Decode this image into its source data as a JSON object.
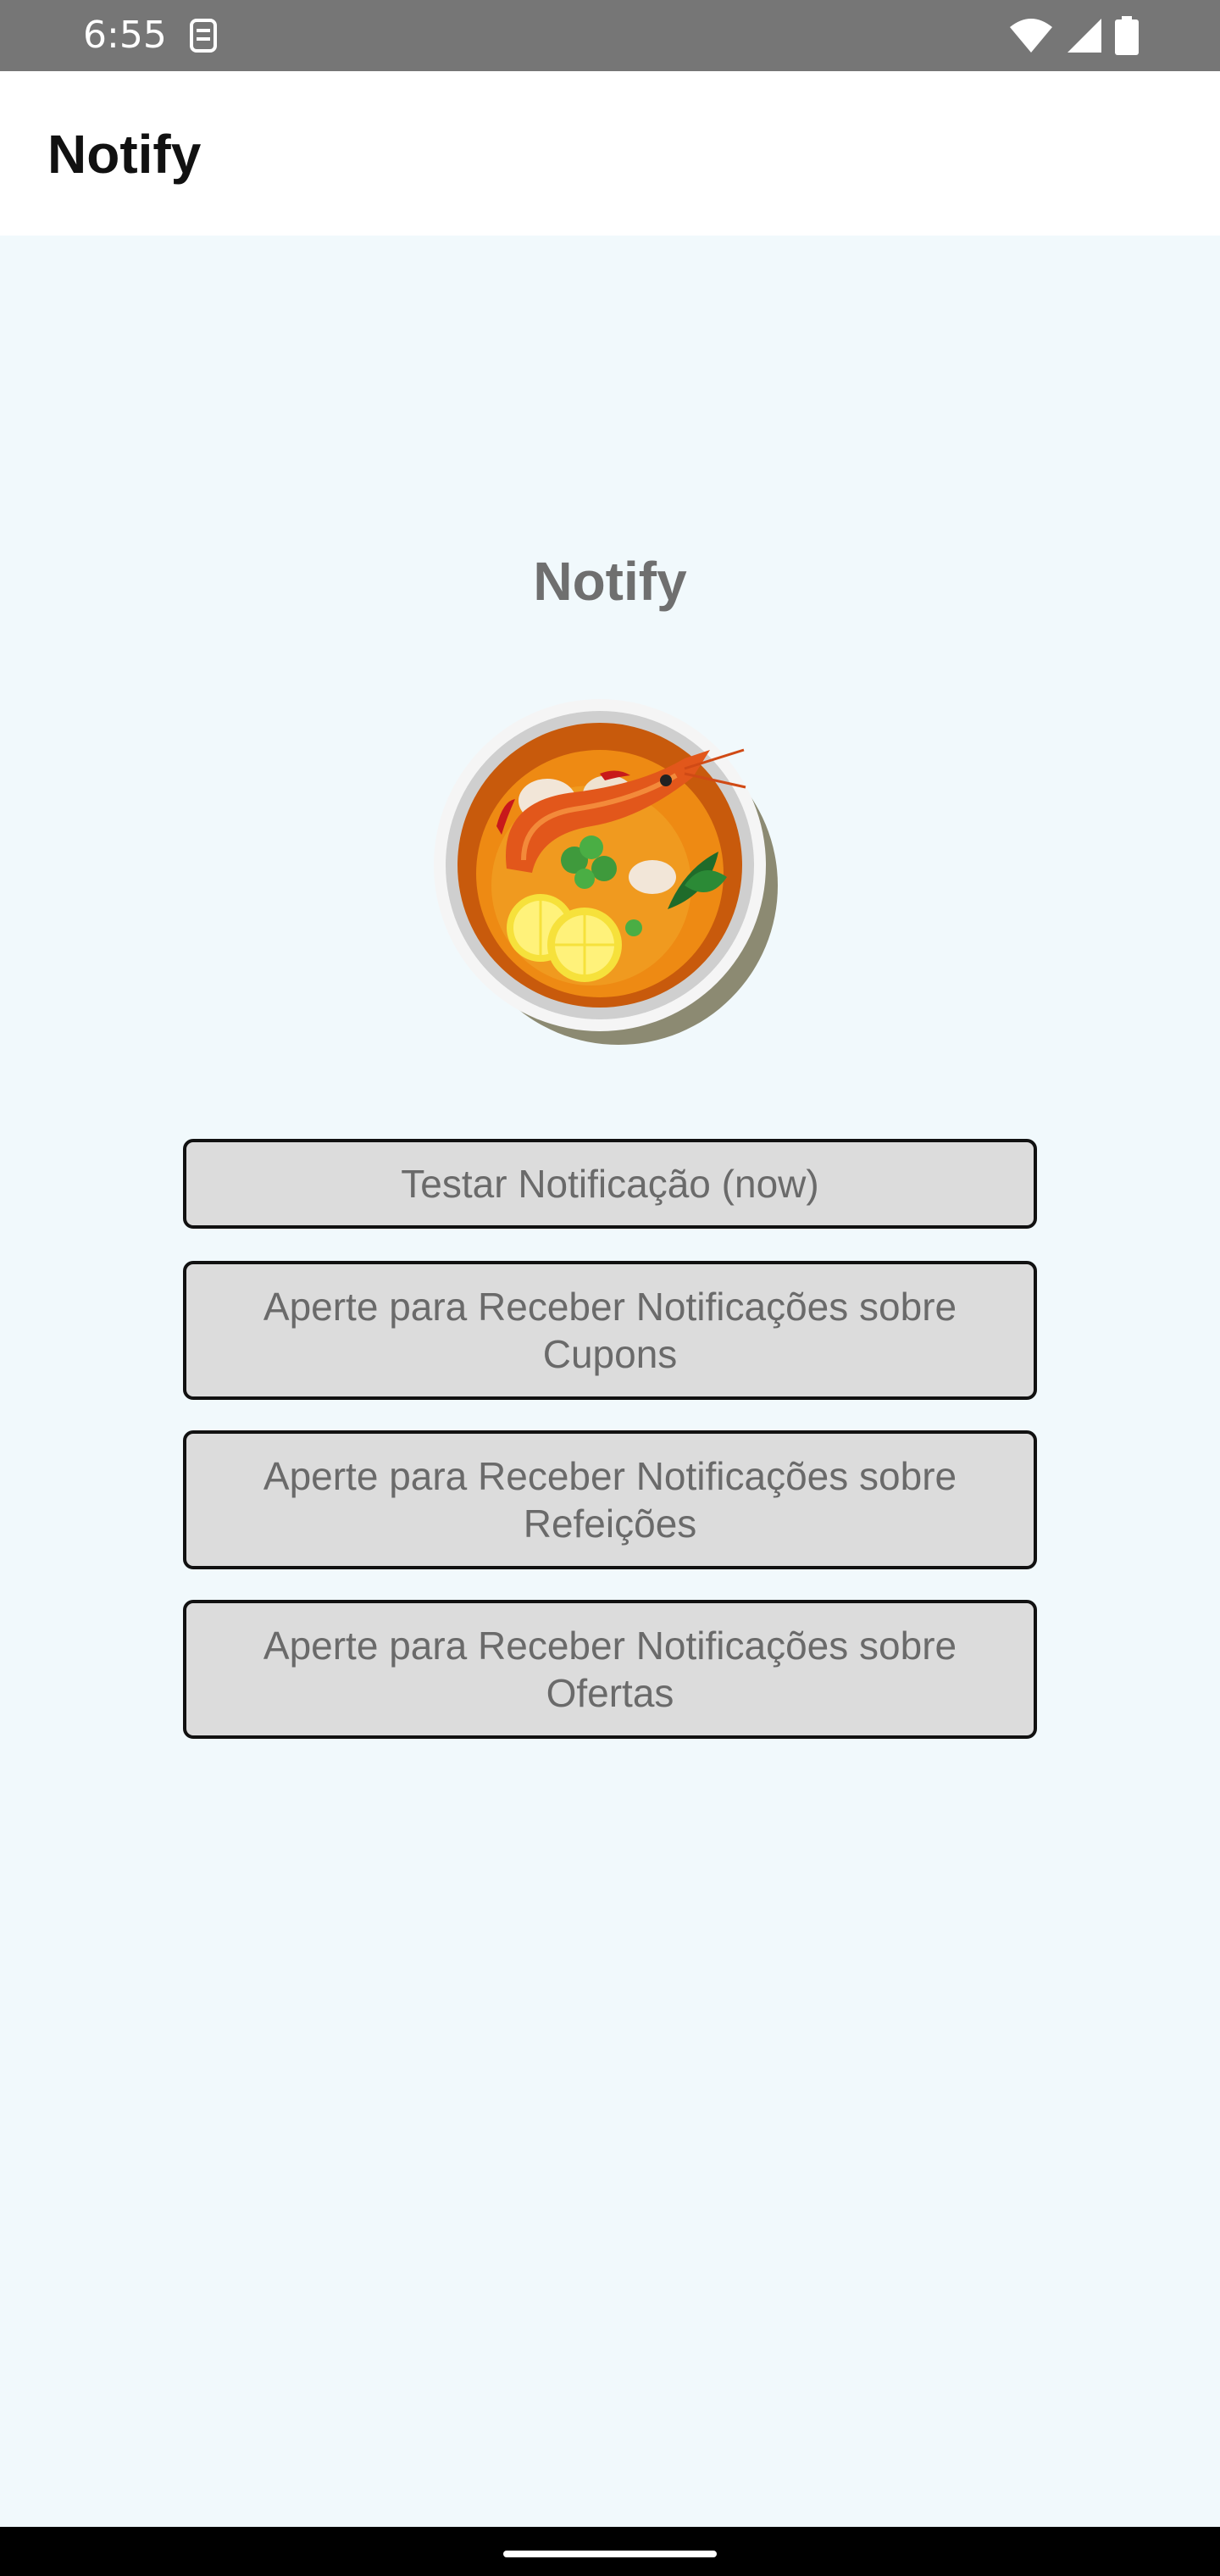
{
  "status_bar": {
    "time": "6:55",
    "icons": [
      "sim-card-icon",
      "wifi-icon",
      "cellular-signal-icon",
      "battery-icon"
    ]
  },
  "app_bar": {
    "title": "Notify"
  },
  "main": {
    "heading": "Notify",
    "illustration": "shrimp-soup-bowl-image",
    "buttons": [
      {
        "label": "Testar Notificação (now)"
      },
      {
        "label": "Aperte para Receber Notificações sobre Cupons"
      },
      {
        "label": "Aperte para Receber Notificações sobre Refeições"
      },
      {
        "label": "Aperte para Receber Notificações sobre Ofertas"
      }
    ]
  },
  "colors": {
    "status_bar_bg": "#767676",
    "background": "#f1f9fc",
    "button_bg": "#dcdcdc",
    "button_border": "#111111",
    "heading_text": "#6f6f6f"
  }
}
